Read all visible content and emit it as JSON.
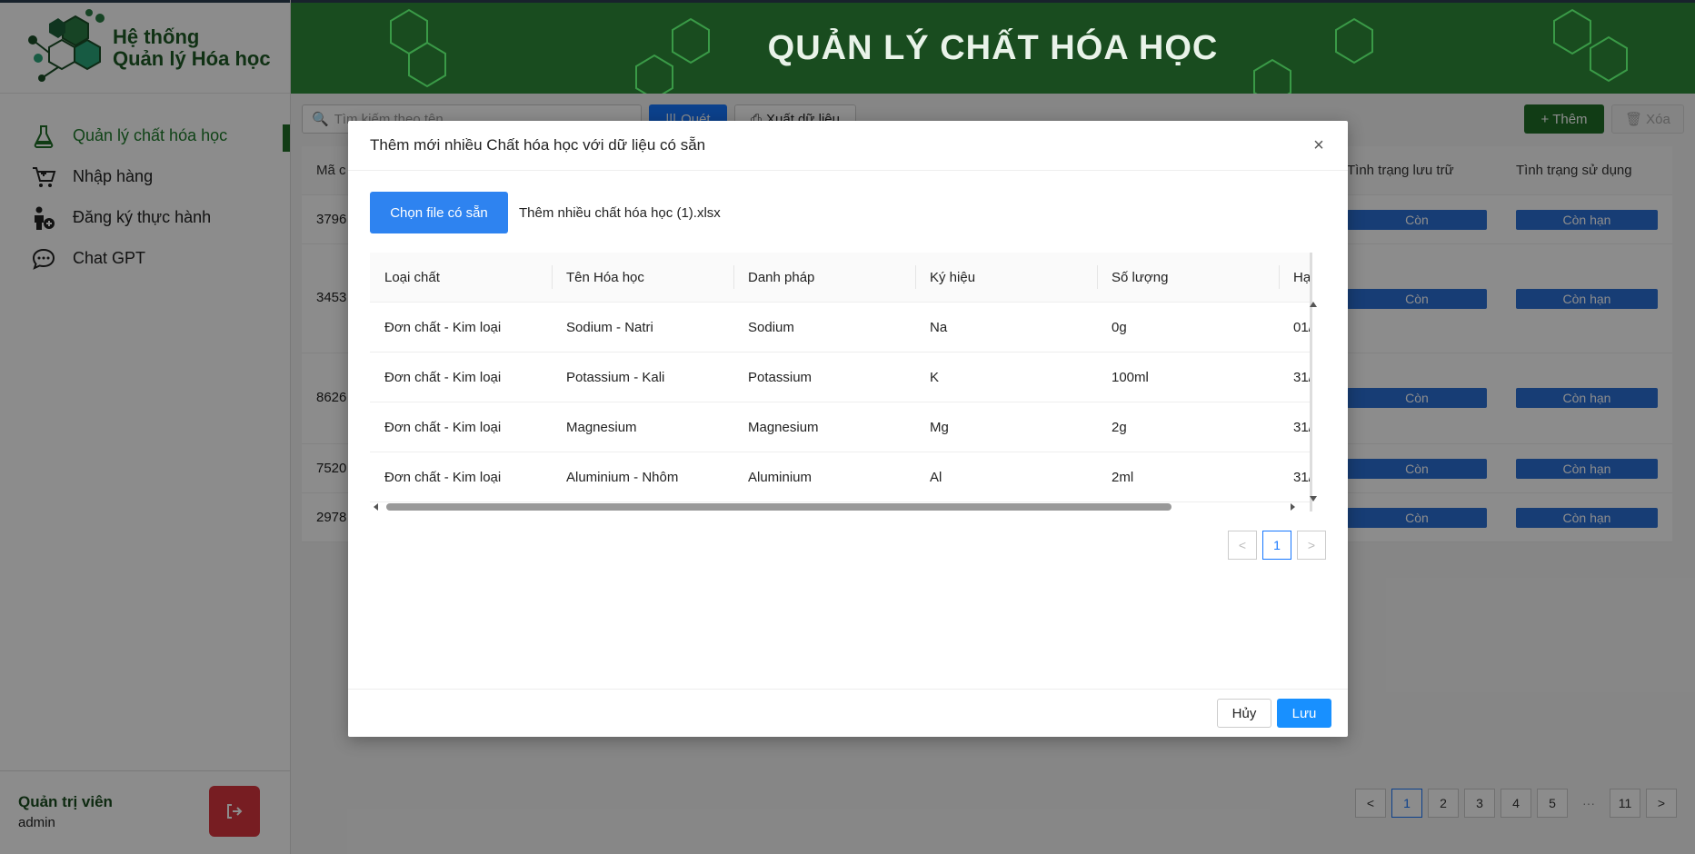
{
  "app": {
    "logo_line1": "Hệ thống",
    "logo_line2": "Quản lý Hóa học",
    "header_title": "QUẢN LÝ CHẤT HÓA HỌC"
  },
  "sidebar": {
    "items": [
      {
        "label": "Quản lý chất hóa học",
        "icon": "flask-icon"
      },
      {
        "label": "Nhập hàng",
        "icon": "cart-icon"
      },
      {
        "label": "Đăng ký thực hành",
        "icon": "person-add-icon"
      },
      {
        "label": "Chat GPT",
        "icon": "chat-icon"
      }
    ],
    "user_name": "Quản trị viên",
    "user_role": "admin"
  },
  "toolbar": {
    "search_placeholder": "Tìm kiếm theo tên",
    "scan_label": "Quét",
    "export_label": "Xuất dữ liệu",
    "add_label": "Thêm",
    "delete_label": "Xóa"
  },
  "bg_table": {
    "headers": [
      "Mã c",
      "Tình trạng lưu trữ",
      "Tình trạng sử dụng"
    ],
    "rows": [
      {
        "code": "3796",
        "storage": "Còn",
        "usage": "Còn hạn"
      },
      {
        "code": "3453",
        "storage": "Còn",
        "usage": "Còn hạn"
      },
      {
        "code": "8626",
        "storage": "Còn",
        "usage": "Còn hạn"
      },
      {
        "code": "7520",
        "storage": "Còn",
        "usage": "Còn hạn"
      },
      {
        "code": "2978",
        "storage": "Còn",
        "usage": "Còn hạn"
      }
    ]
  },
  "bg_pager": {
    "pages": [
      "1",
      "2",
      "3",
      "4",
      "5",
      "···",
      "11"
    ],
    "prev": "<",
    "next": ">"
  },
  "modal": {
    "title": "Thêm mới nhiều Chất hóa học với dữ liệu có sẵn",
    "close": "×",
    "file_button": "Chọn file có sẵn",
    "file_name": "Thêm nhiều chất hóa học (1).xlsx",
    "columns": [
      "Loại chất",
      "Tên Hóa học",
      "Danh pháp",
      "Ký hiệu",
      "Số lượng",
      "Hạ"
    ],
    "rows": [
      [
        "Đơn chất - Kim loại",
        "Sodium - Natri",
        "Sodium",
        "Na",
        "0g",
        "01/"
      ],
      [
        "Đơn chất - Kim loại",
        "Potassium - Kali",
        "Potassium",
        "K",
        "100ml",
        "31/"
      ],
      [
        "Đơn chất - Kim loại",
        "Magnesium",
        "Magnesium",
        "Mg",
        "2g",
        "31/"
      ],
      [
        "Đơn chất - Kim loại",
        "Aluminium - Nhôm",
        "Aluminium",
        "Al",
        "2ml",
        "31/"
      ]
    ],
    "pager": {
      "prev": "<",
      "page": "1",
      "next": ">"
    },
    "cancel_label": "Hủy",
    "save_label": "Lưu"
  }
}
